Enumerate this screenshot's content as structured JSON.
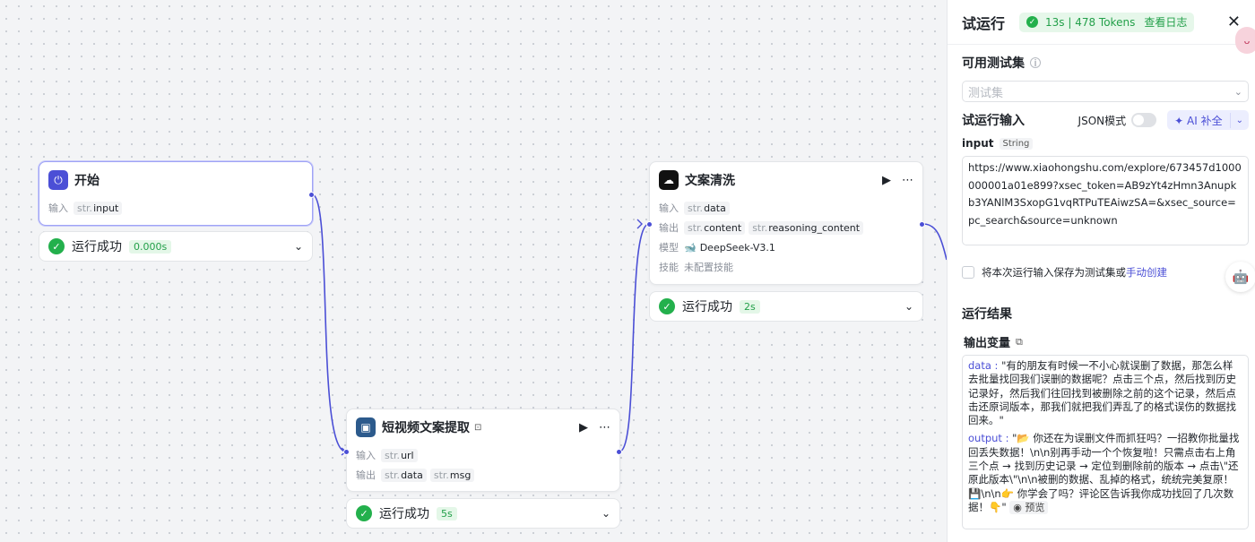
{
  "nodes": {
    "start": {
      "title": "开始",
      "input_label": "输入",
      "input_type": "str.",
      "input_name": "input",
      "status_text": "运行成功",
      "status_time": "0.000s"
    },
    "extract": {
      "title": "短视频文案提取",
      "input_label": "输入",
      "input_type": "str.",
      "input_name": "url",
      "output_label": "输出",
      "outputs": [
        {
          "type": "str.",
          "name": "data"
        },
        {
          "type": "str.",
          "name": "msg"
        }
      ],
      "status_text": "运行成功",
      "status_time": "5s"
    },
    "clean": {
      "title": "文案清洗",
      "input_label": "输入",
      "input_type": "str.",
      "input_name": "data",
      "output_label": "输出",
      "outputs": [
        {
          "type": "str.",
          "name": "content"
        },
        {
          "type": "str.",
          "name": "reasoning_content"
        }
      ],
      "model_label": "模型",
      "model_name": "DeepSeek-V3.1",
      "skill_label": "技能",
      "skill_value": "未配置技能",
      "status_text": "运行成功",
      "status_time": "2s"
    }
  },
  "panel": {
    "title": "试运行",
    "badge_stats": "13s | 478 Tokens",
    "badge_link": "查看日志",
    "testset_label": "可用测试集",
    "testset_placeholder": "测试集",
    "run_input_label": "试运行输入",
    "json_mode_label": "JSON模式",
    "ai_fill_label": "AI 补全",
    "input_field_name": "input",
    "input_field_type": "String",
    "input_value": "https://www.xiaohongshu.com/explore/673457d1000000001a01e899?xsec_token=AB9zYt4zHmn3Anupkb3YANlM3SxopG1vqRTPuTEAiwzSA=&xsec_source=pc_search&source=unknown",
    "save_text": "将本次运行输入保存为测试集或",
    "save_link": "手动创建",
    "result_title": "运行结果",
    "output_vars_label": "输出变量",
    "result_data_key": "data",
    "result_data_value": "\"有的朋友有时候一不小心就误删了数据，那怎么样去批量找回我们误删的数据呢？点击三个点，然后找到历史记录好，然后我们往回找到被删除之前的这个记录，然后点击还原词版本，那我们就把我们弄乱了的格式误伤的数据找回来。\"",
    "result_output_key": "output",
    "result_output_value": "\"📂 你还在为误删文件而抓狂吗？一招教你批量找回丢失数据！\\n\\n别再手动一个个恢复啦！只需点击右上角三个点 → 找到历史记录 → 定位到删除前的版本 → 点击\\\"还原此版本\\\"\\n\\n被删的数据、乱掉的格式，统统完美复原！💾\\n\\n👉 你学会了吗？评论区告诉我你成功找回了几次数据！👇\"",
    "preview_label": "预览"
  },
  "colors": {
    "accent": "#4b4fd6",
    "success": "#23b04c",
    "edge": "#4b4fd6"
  }
}
